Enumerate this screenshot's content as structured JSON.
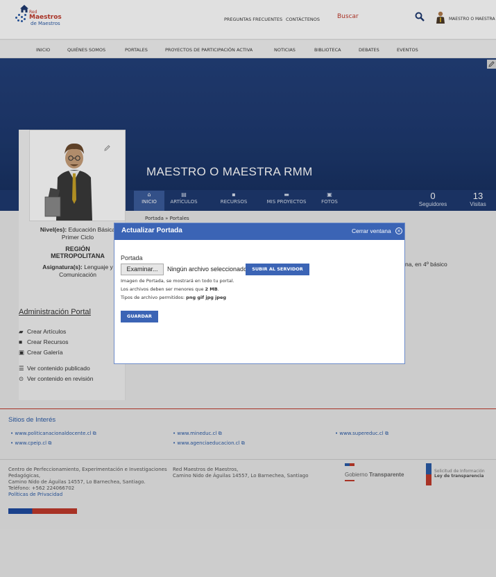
{
  "header": {
    "logo": {
      "line1": "Red",
      "line2": "Maestros",
      "line3": "de Maestros"
    },
    "links": [
      "PREGUNTAS FRECUENTES",
      "CONTÁCTENOS"
    ],
    "search_placeholder": "Buscar",
    "username": "MAESTRO O MAESTRA"
  },
  "nav": {
    "items": [
      "INICIO",
      "QUIÉNES SOMOS",
      "PORTALES",
      "PROYECTOS DE PARTICIPACIÓN ACTIVA",
      "NOTICIAS",
      "BIBLIOTECA",
      "DEBATES",
      "EVENTOS"
    ]
  },
  "profile": {
    "title": "MAESTRO O MAESTRA RMM",
    "tabs": [
      {
        "label": "INICIO",
        "icon": "home-icon",
        "icon_glyph": "⌂"
      },
      {
        "label": "ARTÍCULOS",
        "icon": "articles-icon",
        "icon_glyph": "▤"
      },
      {
        "label": "RECURSOS",
        "icon": "resources-icon",
        "icon_glyph": "▪"
      },
      {
        "label": "MIS PROYECTOS",
        "icon": "folder-icon",
        "icon_glyph": "▬"
      },
      {
        "label": "FOTOS",
        "icon": "photos-icon",
        "icon_glyph": "▣"
      }
    ],
    "followers": {
      "count": "0",
      "label": "Seguidores"
    },
    "visits": {
      "count": "13",
      "label": "Visitas"
    },
    "niveles_label": "Nivel(es):",
    "niveles_value": "Educación Básica",
    "niveles_value2": "Primer Ciclo",
    "region_line1": "REGIÓN",
    "region_line2": "METROPOLITANA",
    "asignatura_label": "Asignatura(s):",
    "asignatura_value": "Lenguaje y",
    "asignatura_value2": "Comunicación"
  },
  "breadcrumb": "Portada » Portales",
  "behind_text": "na, en 4º básico",
  "admin": {
    "title": "Administración Portal",
    "links": [
      "Crear Artículos",
      "Crear Recursos",
      "Crear Galería",
      "Ver contenido publicado",
      "Ver contenido en revisión"
    ]
  },
  "modal": {
    "title": "Actualizar Portada",
    "close_label": "Cerrar ventana",
    "field_label": "Portada",
    "browse_label": "Examinar...",
    "file_status": "Ningún archivo seleccionado.",
    "upload_label": "SUBIR AL SERVIDOR",
    "note1": "Imagen de Portada, se mostrará en todo tu portal.",
    "note2_prefix": "Los archivos deben ser menores que",
    "note2_value": "2 MB",
    "note3_prefix": "Tipos de archivo permitidos:",
    "note3_value": "png gif jpg jpeg",
    "save_label": "GUARDAR"
  },
  "footer": {
    "sitios_title": "Sitios de Interés",
    "sitios": [
      "www.politicanacionaldocente.cl",
      "www.mineduc.cl",
      "www.supereduc.cl",
      "www.cpeip.cl",
      "www.agenciaeducacion.cl"
    ],
    "cpeip_line1": "Centro de Perfeccionamiento, Experimentación e Investigaciones",
    "cpeip_line2": "Pedagógicas,",
    "cpeip_line3": "Camino Nido de Águilas 14557, Lo Barnechea, Santiago.",
    "cpeip_line4": "Teléfono: +562 224066702",
    "privacy": "Políticas de Privacidad",
    "rmm_line1": "Red Maestros de Maestros,",
    "rmm_line2": "Camino Nido de Águilas 14557, Lo Barnechea, Santiago",
    "gob_prefix": "Gobierno",
    "gob_bold": "Transparente",
    "ley_line1": "Solicitud de Información",
    "ley_line2": "Ley de transparencia"
  }
}
